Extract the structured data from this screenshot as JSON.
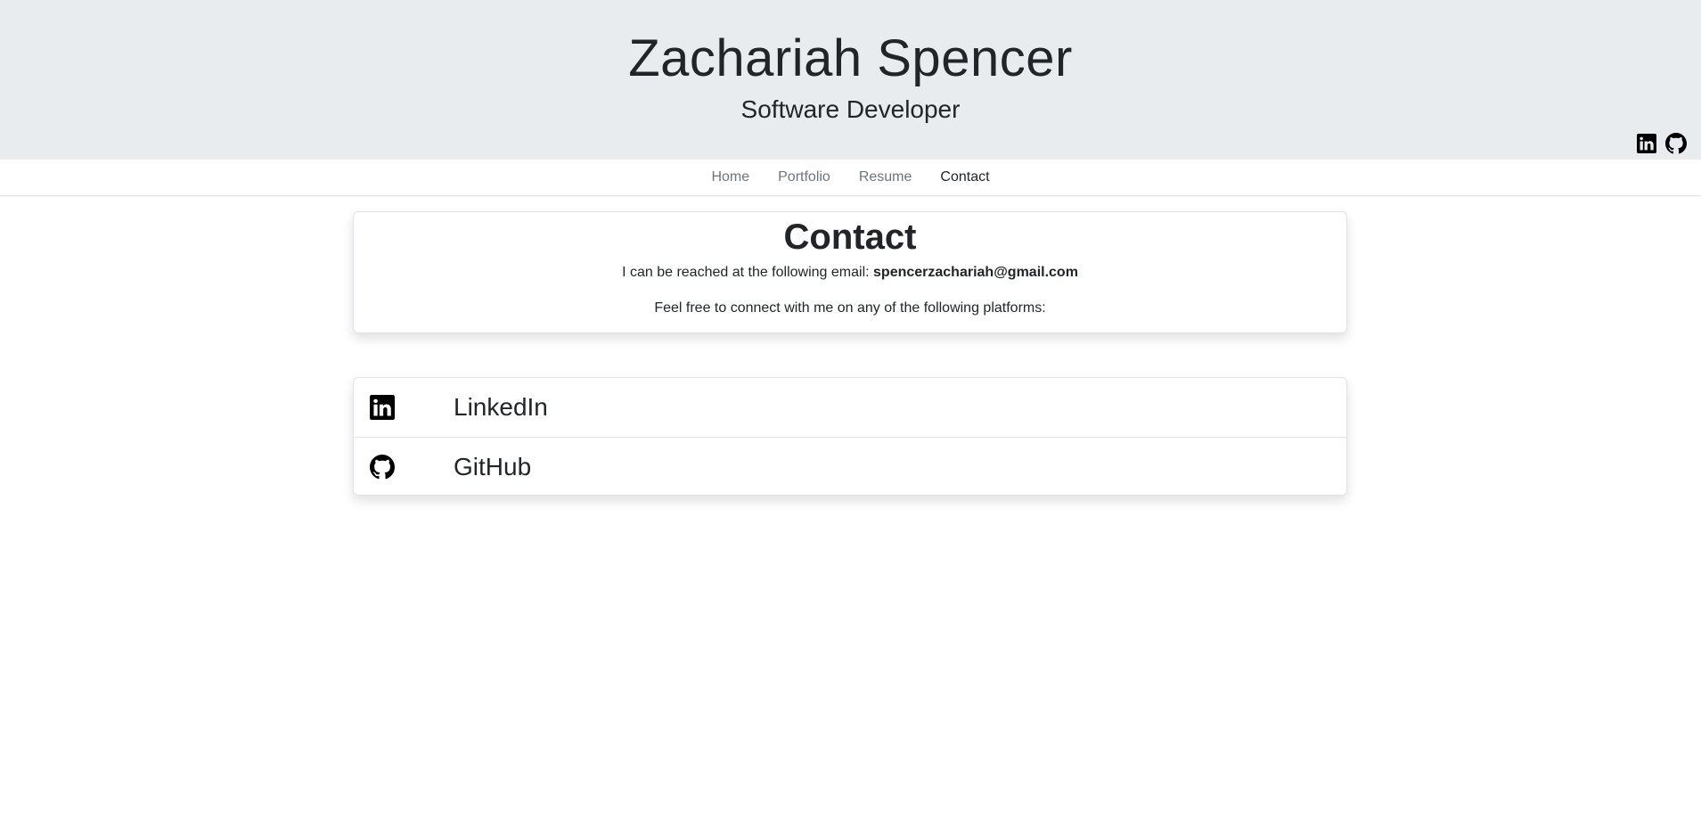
{
  "header": {
    "name": "Zachariah Spencer",
    "role": "Software Developer",
    "social_icons": [
      "linkedin-icon",
      "github-icon"
    ]
  },
  "nav": {
    "items": [
      {
        "label": "Home",
        "active": false
      },
      {
        "label": "Portfolio",
        "active": false
      },
      {
        "label": "Resume",
        "active": false
      },
      {
        "label": "Contact",
        "active": true
      }
    ]
  },
  "contact": {
    "title": "Contact",
    "email_prefix": "I can be reached at the following email: ",
    "email": "spencerzachariah@gmail.com",
    "platforms_text": "Feel free to connect with me on any of the following platforms:"
  },
  "links": [
    {
      "label": "LinkedIn",
      "icon": "linkedin-icon"
    },
    {
      "label": "GitHub",
      "icon": "github-icon"
    }
  ],
  "colors": {
    "header_bg": "#e9ecef",
    "text": "#212529",
    "nav_inactive": "#6c757d",
    "border": "#dfe2e6"
  }
}
